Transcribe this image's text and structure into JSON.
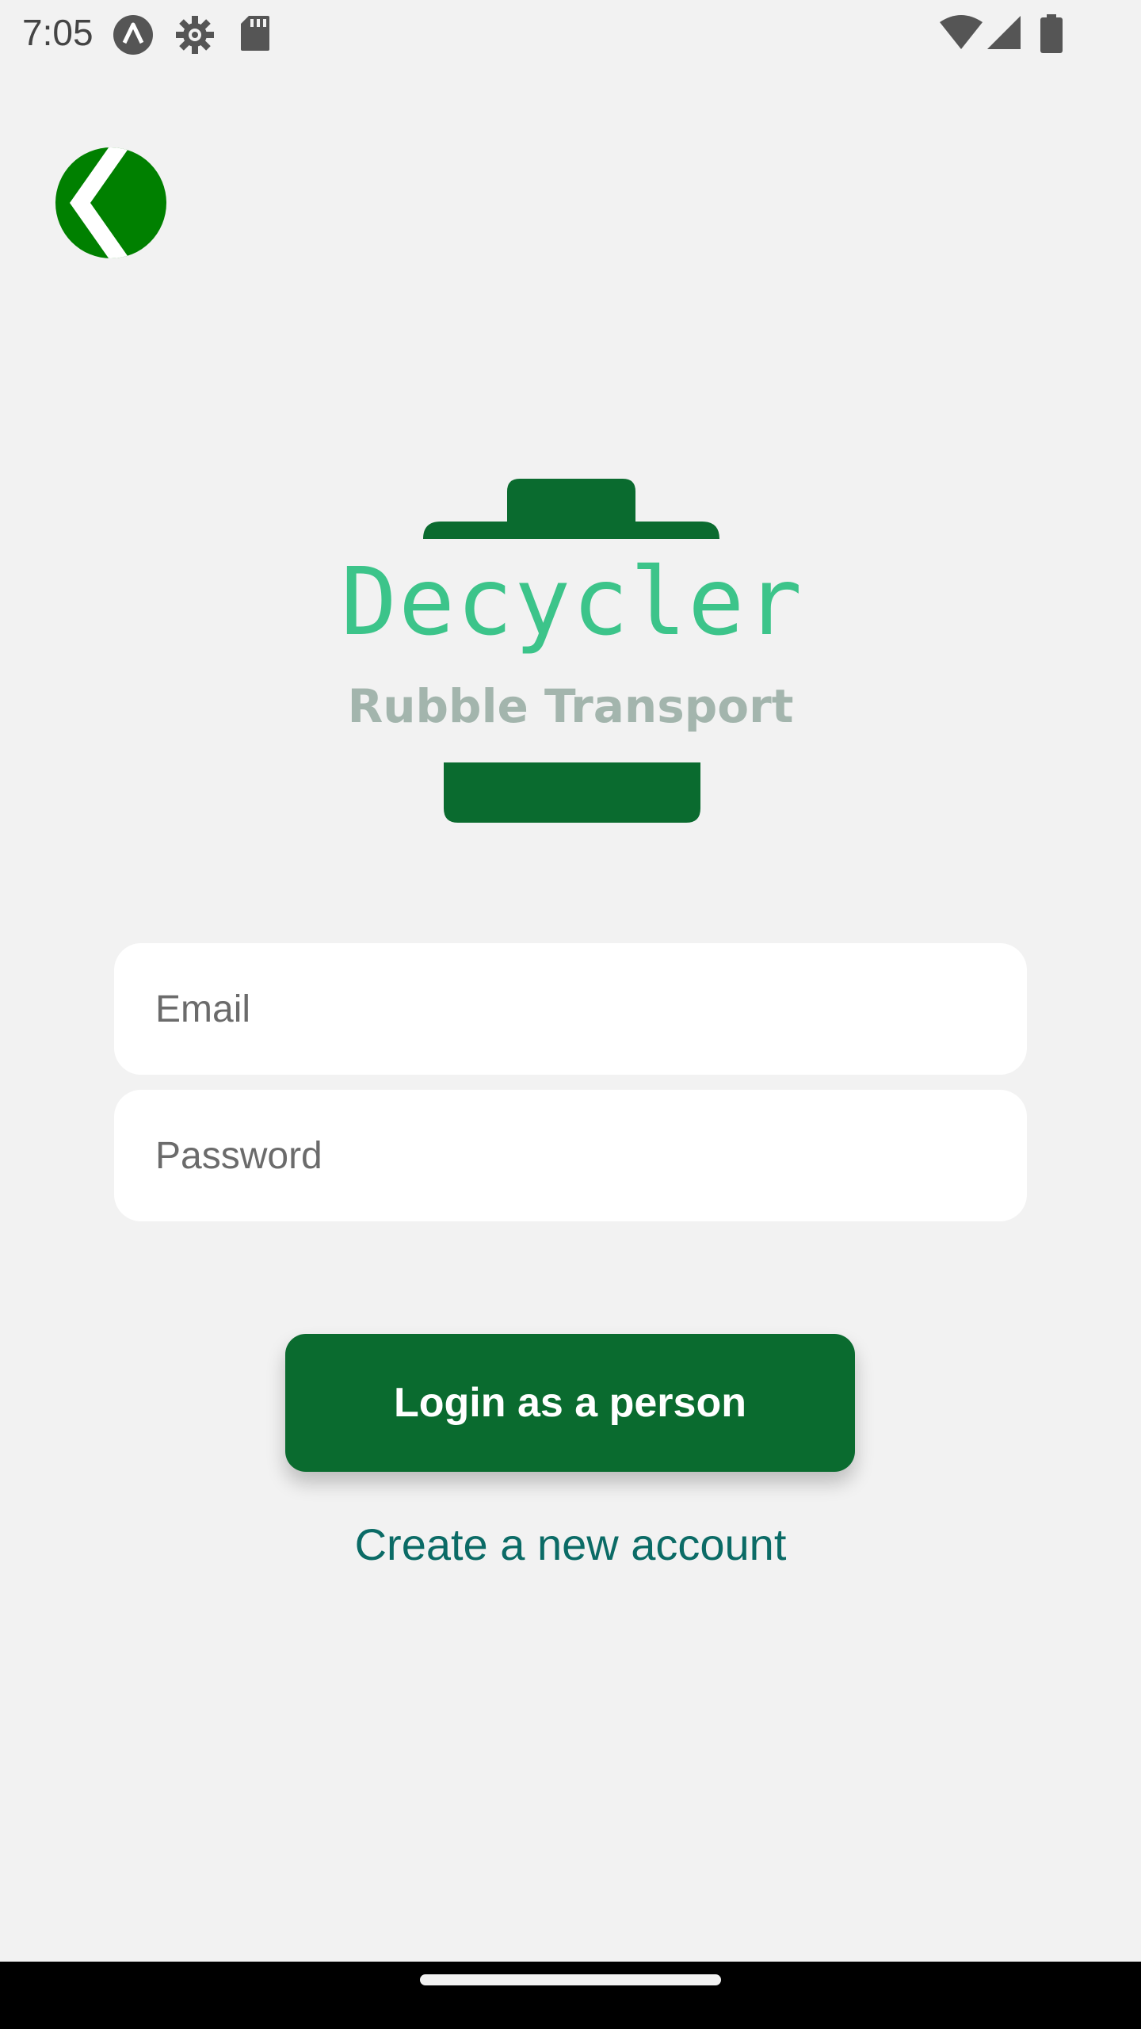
{
  "status_bar": {
    "time": "7:05",
    "icons_left": [
      "app-a-icon",
      "settings-gear-icon",
      "sd-card-icon"
    ],
    "icons_right": [
      "wifi-icon",
      "cell-signal-icon",
      "battery-icon"
    ]
  },
  "back_button": {
    "icon": "chevron-left-icon",
    "color": "#008000"
  },
  "logo": {
    "wordmark": "Decycler",
    "subtitle": "Rubble Transport",
    "colors": {
      "bin": "#0a6b2f",
      "wordmark": "#3cc48a",
      "subtitle": "#a3b5ad"
    }
  },
  "form": {
    "email_placeholder": "Email",
    "email_value": "",
    "password_placeholder": "Password",
    "password_value": "",
    "login_label": "Login as a person",
    "create_account_label": "Create a new account"
  },
  "colors": {
    "background": "#f2f2f2",
    "primary": "#0a6b2f",
    "link": "#0b6b66"
  }
}
